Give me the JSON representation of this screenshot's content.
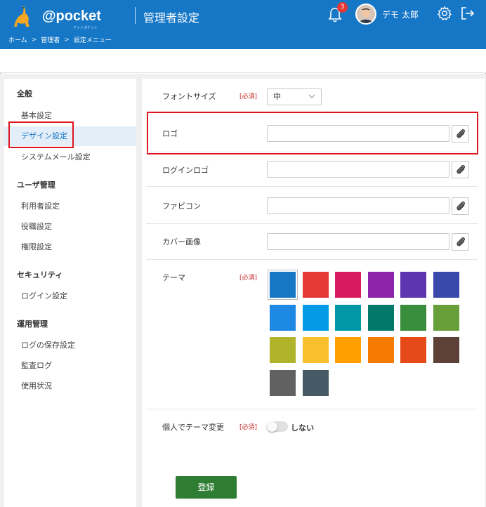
{
  "header": {
    "logo_text": "@pocket",
    "logo_sub": "アットポケット",
    "app_title": "管理者設定",
    "notification_count": "3",
    "user_name": "デモ 太郎",
    "breadcrumb": [
      "ホーム",
      "管理者",
      "設定メニュー"
    ],
    "breadcrumb_sep": ">"
  },
  "sidebar": {
    "sections": [
      {
        "title": "全般",
        "items": [
          "基本設定",
          "デザイン設定",
          "システムメール設定"
        ]
      },
      {
        "title": "ユーザ管理",
        "items": [
          "利用者設定",
          "役職設定",
          "権限設定"
        ]
      },
      {
        "title": "セキュリティ",
        "items": [
          "ログイン設定"
        ]
      },
      {
        "title": "運用管理",
        "items": [
          "ログの保存設定",
          "監査ログ",
          "使用状況"
        ]
      }
    ],
    "active_item": "デザイン設定"
  },
  "form": {
    "font_size": {
      "label": "フォントサイズ",
      "required": "[必須]",
      "value": "中"
    },
    "logo": {
      "label": "ロゴ",
      "value": ""
    },
    "login_logo": {
      "label": "ログインロゴ",
      "value": ""
    },
    "favicon": {
      "label": "ファビコン",
      "value": ""
    },
    "cover_image": {
      "label": "カバー画像",
      "value": ""
    },
    "theme": {
      "label": "テーマ",
      "required": "[必須]",
      "colors": [
        "#1577c6",
        "#e53935",
        "#d81b60",
        "#8e24aa",
        "#5e35b1",
        "#3949ab",
        "#1e88e5",
        "#039be5",
        "#0097a7",
        "#00796b",
        "#388e3c",
        "#689f38",
        "#afb42b",
        "#fbc02d",
        "#ffa000",
        "#f57c00",
        "#e64a19",
        "#5d4037",
        "#616161",
        "#455a64"
      ],
      "selected_index": 0
    },
    "personal_theme": {
      "label": "個人でテーマ変更",
      "required": "[必須]",
      "toggle_label": "しない",
      "enabled": false
    },
    "submit_label": "登録"
  }
}
